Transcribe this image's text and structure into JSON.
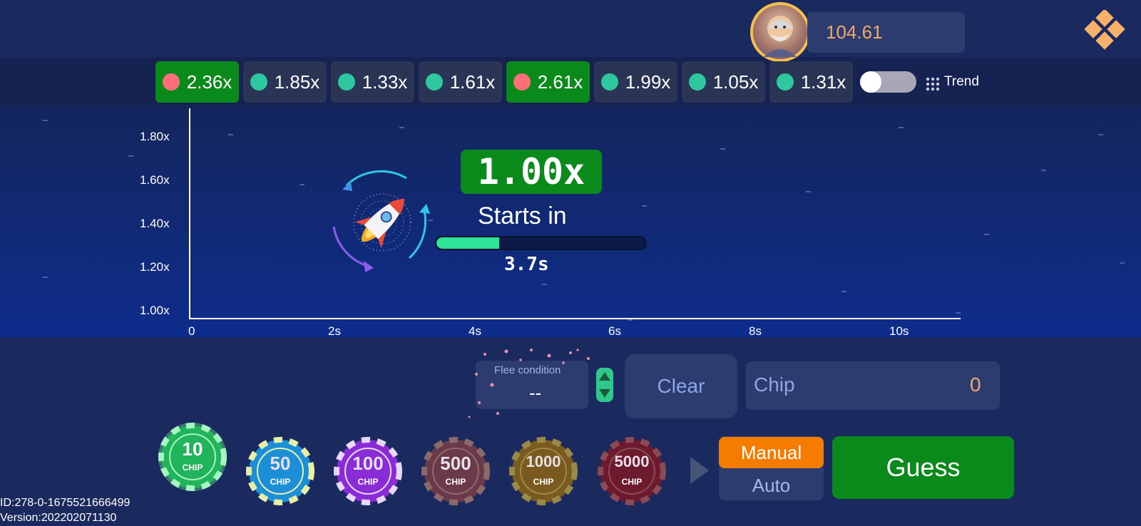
{
  "header": {
    "balance": "104.61",
    "avatar_icon": "player-avatar",
    "menu_icon": "diamond-menu-icon"
  },
  "history": [
    {
      "value": "2.36x",
      "status": "win"
    },
    {
      "value": "1.85x",
      "status": "normal"
    },
    {
      "value": "1.33x",
      "status": "normal"
    },
    {
      "value": "1.61x",
      "status": "normal"
    },
    {
      "value": "2.61x",
      "status": "win"
    },
    {
      "value": "1.99x",
      "status": "normal"
    },
    {
      "value": "1.05x",
      "status": "normal"
    },
    {
      "value": "1.31x",
      "status": "normal"
    }
  ],
  "trend": {
    "label": "Trend",
    "toggle_on": false
  },
  "chart_data": {
    "type": "line",
    "y_ticks": [
      "1.80x",
      "1.60x",
      "1.40x",
      "1.20x",
      "1.00x"
    ],
    "x_ticks": [
      "0",
      "2s",
      "4s",
      "6s",
      "8s",
      "10s"
    ],
    "ylim": [
      1.0,
      1.8
    ],
    "xlim": [
      0,
      11
    ],
    "series": []
  },
  "round": {
    "multiplier": "1.00x",
    "starts_in_label": "Starts in",
    "countdown": "3.7s",
    "progress_fraction": 0.3
  },
  "controls": {
    "flee_label": "Flee condition",
    "flee_value": "--",
    "clear_label": "Clear",
    "chip_label": "Chip",
    "chip_value": "0",
    "manual_label": "Manual",
    "auto_label": "Auto",
    "guess_label": "Guess"
  },
  "chips": [
    {
      "amount": "10",
      "word": "CHIP",
      "color": "#22b45a",
      "rim": "#a4f5c0",
      "selected": true
    },
    {
      "amount": "50",
      "word": "CHIP",
      "color": "#1d8fd8",
      "rim": "#e8f0a8",
      "selected": false
    },
    {
      "amount": "100",
      "word": "CHIP",
      "color": "#8a2cd6",
      "rim": "#e8d8f8",
      "selected": false
    },
    {
      "amount": "500",
      "word": "CHIP",
      "color": "#6b3a4a",
      "rim": "#8d6a6a",
      "selected": false
    },
    {
      "amount": "1000",
      "word": "CHIP",
      "color": "#7a5a1e",
      "rim": "#9a8a4a",
      "selected": false
    },
    {
      "amount": "5000",
      "word": "CHIP",
      "color": "#6e1a2e",
      "rim": "#8a4a56",
      "selected": false
    }
  ],
  "footer": {
    "id": "ID:278-0-1675521666499",
    "version": "Version:202202071130"
  }
}
